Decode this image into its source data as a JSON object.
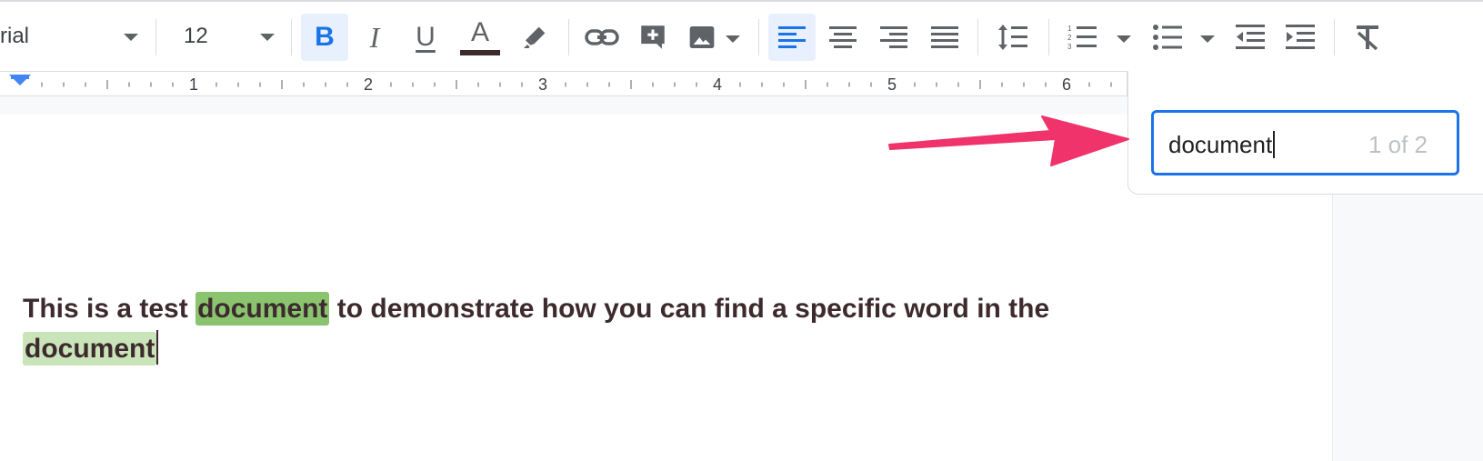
{
  "toolbar": {
    "font_name": "rial",
    "font_size": "12",
    "buttons": {
      "bold": "B",
      "italic": "I",
      "underline": "U",
      "text_color": "A"
    },
    "text_color_swatch": "#3d2a2e",
    "active_color": "#1a73e8"
  },
  "ruler": {
    "numbers": [
      "1",
      "2",
      "3",
      "4",
      "5",
      "6"
    ]
  },
  "find": {
    "value": "document",
    "count": "1 of 2"
  },
  "document": {
    "part1": "This is a test ",
    "match1": "document",
    "part2": " to demonstrate how you can find a specific word in the",
    "match2": "document"
  },
  "colors": {
    "current_match": "#8bc46f",
    "other_match": "#c9e4b9",
    "arrow": "#f0336b"
  }
}
